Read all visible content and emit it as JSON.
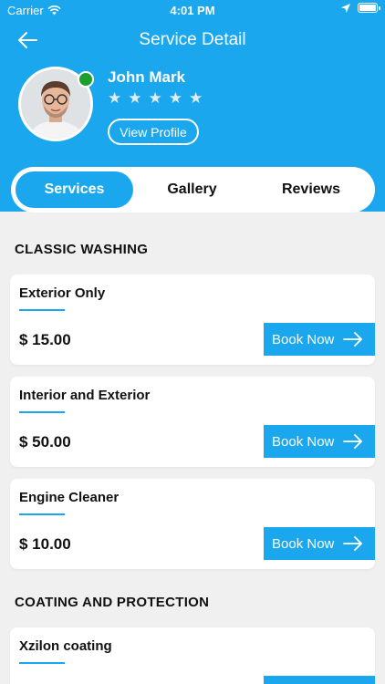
{
  "status_bar": {
    "carrier": "Carrier",
    "time": "4:01 PM"
  },
  "nav": {
    "title": "Service Detail"
  },
  "profile": {
    "name": "John Mark",
    "star_count": 5,
    "rating": 0,
    "view_profile_label": "View Profile"
  },
  "tabs": [
    {
      "label": "Services",
      "active": true
    },
    {
      "label": "Gallery",
      "active": false
    },
    {
      "label": "Reviews",
      "active": false
    }
  ],
  "sections": [
    {
      "title": "CLASSIC WASHING",
      "services": [
        {
          "name": "Exterior Only",
          "price": "$ 15.00",
          "button_label": "Book Now"
        },
        {
          "name": "Interior and Exterior",
          "price": "$ 50.00",
          "button_label": "Book Now"
        },
        {
          "name": "Engine Cleaner",
          "price": "$ 10.00",
          "button_label": "Book Now"
        }
      ]
    },
    {
      "title": "COATING AND PROTECTION",
      "services": [
        {
          "name": "Xzilon coating",
          "price": "",
          "button_label": ""
        }
      ]
    }
  ],
  "colors": {
    "primary": "#1aa7ee",
    "background": "#f0f0f0",
    "online": "#1e9e2a"
  },
  "icons": [
    "wifi-icon",
    "location-arrow-icon",
    "battery-icon",
    "back-arrow-icon",
    "star-icon",
    "arrow-right-icon"
  ]
}
